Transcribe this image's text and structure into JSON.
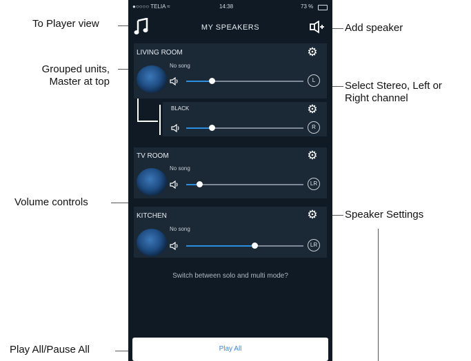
{
  "status": {
    "carrier": "●○○○○ TELIA ≈",
    "time": "14:38",
    "battery": "73 %"
  },
  "nav": {
    "title": "MY SPEAKERS"
  },
  "speakers": [
    {
      "name": "LIVING ROOM",
      "song": "No song",
      "volume": 0.22,
      "channel": "L"
    },
    {
      "name": "BLACK",
      "song": "",
      "volume": 0.22,
      "channel": "R"
    },
    {
      "name": "TV ROOM",
      "song": "No song",
      "volume": 0.11,
      "channel": "LR"
    },
    {
      "name": "KITCHEN",
      "song": "No song",
      "volume": 0.58,
      "channel": "LR"
    }
  ],
  "switch_mode_text": "Switch between solo and multi mode?",
  "play_all_label": "Play All",
  "callouts": {
    "to_player_view": "To Player view",
    "add_speaker": "Add speaker",
    "grouped_units_1": "Grouped units,",
    "grouped_units_2": "Master at top",
    "select_channel_1": "Select Stereo, Left or",
    "select_channel_2": "Right channel",
    "volume_controls": "Volume controls",
    "speaker_settings": "Speaker Settings",
    "play_pause_all": "Play All/Pause All"
  },
  "colors": {
    "background": "#0f1a24",
    "card": "#1b2836",
    "accent": "#2c8fe0"
  },
  "icons": {
    "player_view": "music-note-icon",
    "add_speaker": "add-speaker-icon",
    "settings": "gear-icon",
    "volume": "speaker-icon"
  }
}
